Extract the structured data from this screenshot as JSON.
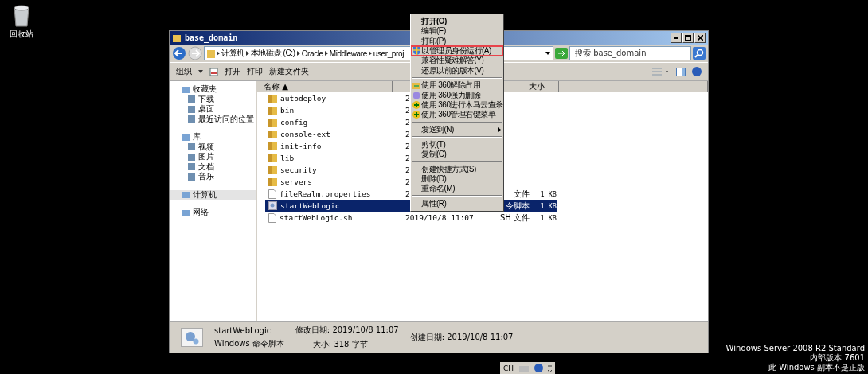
{
  "desktop": {
    "icons": [
      {
        "label": "回收站"
      }
    ]
  },
  "window": {
    "title": "base_domain"
  },
  "address_bar": {
    "path": [
      "计算机",
      "本地磁盘 (C:)",
      "Oracle",
      "Middleware",
      "user_proj"
    ]
  },
  "search": {
    "placeholder": "搜索 base_domain"
  },
  "toolbar": [
    {
      "label": "组织",
      "kind": "dropdown"
    },
    {
      "label": "打开",
      "kind": "icon"
    },
    {
      "label": "打印",
      "kind": "plain"
    },
    {
      "label": "新建文件夹",
      "kind": "plain"
    }
  ],
  "nav_pane": [
    {
      "label": "收藏夹",
      "selected": false,
      "children": [
        {
          "label": "下载",
          "selected": false
        },
        {
          "label": "桌面",
          "selected": false
        },
        {
          "label": "最近访问的位置",
          "selected": false
        }
      ]
    },
    {
      "label": "库",
      "selected": false,
      "children": [
        {
          "label": "视频",
          "selected": false
        },
        {
          "label": "图片",
          "selected": false
        },
        {
          "label": "文档",
          "selected": false
        },
        {
          "label": "音乐",
          "selected": false
        }
      ]
    },
    {
      "label": "计算机",
      "selected": true
    },
    {
      "label": "网络",
      "selected": false
    }
  ],
  "columns": [
    {
      "kind": "name",
      "label": "名称 ▲"
    },
    {
      "kind": "date"
    },
    {
      "kind": "type"
    },
    {
      "kind": "size",
      "label": "大小"
    }
  ],
  "files": [
    {
      "name": "autodeploy",
      "kind": "folder",
      "selected": false,
      "date": "2"
    },
    {
      "name": "bin",
      "kind": "folder",
      "selected": false,
      "date": "2"
    },
    {
      "name": "config",
      "kind": "folder",
      "selected": false,
      "date": "2"
    },
    {
      "name": "console-ext",
      "kind": "folder",
      "selected": false,
      "date": "2"
    },
    {
      "name": "init-info",
      "kind": "folder",
      "selected": false,
      "date": "2"
    },
    {
      "name": "lib",
      "kind": "folder",
      "selected": false,
      "date": "2"
    },
    {
      "name": "security",
      "kind": "folder",
      "selected": false,
      "date": "2"
    },
    {
      "name": "servers",
      "kind": "folder",
      "selected": false,
      "date": "2"
    },
    {
      "name": "fileRealm.properties",
      "kind": "file",
      "selected": false,
      "date": "2",
      "type": "文件",
      "size": "1 KB"
    },
    {
      "name": "startWebLogic",
      "kind": "script",
      "selected": true,
      "type": "令脚本",
      "size": "1 KB"
    },
    {
      "name": "startWebLogic.sh",
      "kind": "file",
      "selected": false,
      "date": "2019/10/8 11:07",
      "type": "SH 文件",
      "size": "1 KB"
    }
  ],
  "context_menu": [
    {
      "kind": "item",
      "label": "打开(O)",
      "default": true,
      "highlighted": false
    },
    {
      "kind": "item",
      "label": "编辑(E)",
      "default": false,
      "highlighted": false
    },
    {
      "kind": "item",
      "label": "打印(P)",
      "default": false,
      "highlighted": false
    },
    {
      "kind": "item",
      "label": "以管理员身份运行(A)",
      "default": false,
      "highlighted": true
    },
    {
      "kind": "item",
      "label": "兼容性疑难解答(Y)",
      "default": false,
      "highlighted": false
    },
    {
      "kind": "item",
      "label": "还原以前的版本(V)",
      "default": false,
      "highlighted": false
    },
    {
      "kind": "separator"
    },
    {
      "kind": "item",
      "label": "使用 360解除占用",
      "default": false,
      "highlighted": false
    },
    {
      "kind": "item",
      "label": "使用 360强力删除",
      "default": false,
      "highlighted": false
    },
    {
      "kind": "item",
      "label": "使用 360进行木马云查杀",
      "default": false,
      "highlighted": false
    },
    {
      "kind": "item",
      "label": "使用 360管理右键菜单",
      "default": false,
      "highlighted": false
    },
    {
      "kind": "separator"
    },
    {
      "kind": "submenu",
      "label": "发送到(N)"
    },
    {
      "kind": "separator"
    },
    {
      "kind": "item",
      "label": "剪切(T)",
      "default": false,
      "highlighted": false
    },
    {
      "kind": "item",
      "label": "复制(C)",
      "default": false,
      "highlighted": false
    },
    {
      "kind": "separator"
    },
    {
      "kind": "item",
      "label": "创建快捷方式(S)",
      "default": false,
      "highlighted": false
    },
    {
      "kind": "item",
      "label": "删除(D)",
      "default": false,
      "highlighted": false
    },
    {
      "kind": "item",
      "label": "重命名(M)",
      "default": false,
      "highlighted": false
    },
    {
      "kind": "separator"
    },
    {
      "kind": "item",
      "label": "属性(R)",
      "default": false,
      "highlighted": false
    }
  ],
  "details": {
    "name": "startWebLogic",
    "type": "Windows 命令脚本",
    "modified": "修改日期: 2019/10/8 11:07",
    "created": "创建日期: 2019/10/8 11:07",
    "size": "大小: 318 字节"
  },
  "language_bar": {
    "label": "CH"
  },
  "system_notice": [
    "Windows Server 2008 R2 Standard",
    "内部版本 7601",
    "此 Windows 副本不是正版"
  ]
}
